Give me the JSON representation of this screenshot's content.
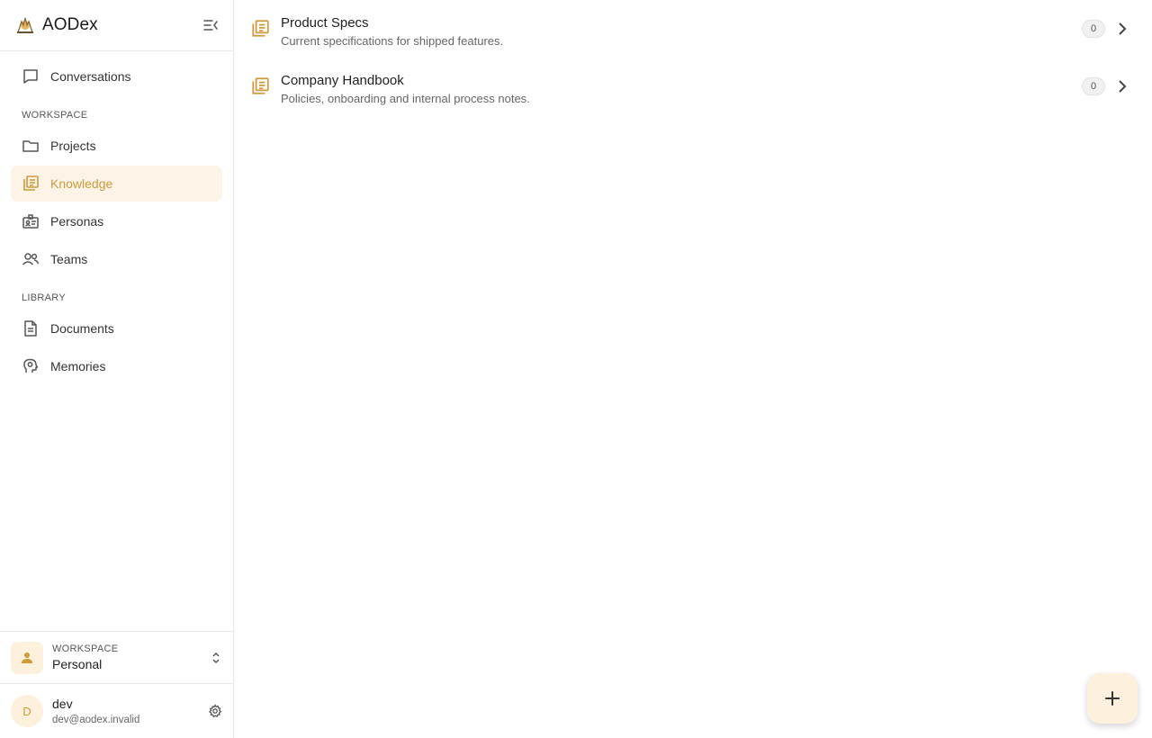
{
  "app": {
    "name": "AODex",
    "accent": "#d09a3a",
    "accent_bg": "#fdf3e6"
  },
  "sidebar": {
    "top_item": {
      "label": "Conversations",
      "icon": "chat-bubble-icon"
    },
    "sections": [
      {
        "label": "WORKSPACE",
        "items": [
          {
            "label": "Projects",
            "icon": "folder-icon"
          },
          {
            "label": "Knowledge",
            "icon": "library-books-icon",
            "active": true
          },
          {
            "label": "Personas",
            "icon": "badge-icon"
          },
          {
            "label": "Teams",
            "icon": "people-icon"
          }
        ]
      },
      {
        "label": "LIBRARY",
        "items": [
          {
            "label": "Documents",
            "icon": "document-icon"
          },
          {
            "label": "Memories",
            "icon": "brain-head-icon"
          }
        ]
      }
    ],
    "workspace": {
      "label": "WORKSPACE",
      "value": "Personal"
    },
    "user": {
      "initial": "D",
      "name": "dev",
      "email": "dev@aodex.invalid"
    }
  },
  "knowledge_bases": [
    {
      "title": "Product Specs",
      "description": "Current specifications for shipped features.",
      "count": "0"
    },
    {
      "title": "Company Handbook",
      "description": "Policies, onboarding and internal process notes.",
      "count": "0"
    }
  ]
}
